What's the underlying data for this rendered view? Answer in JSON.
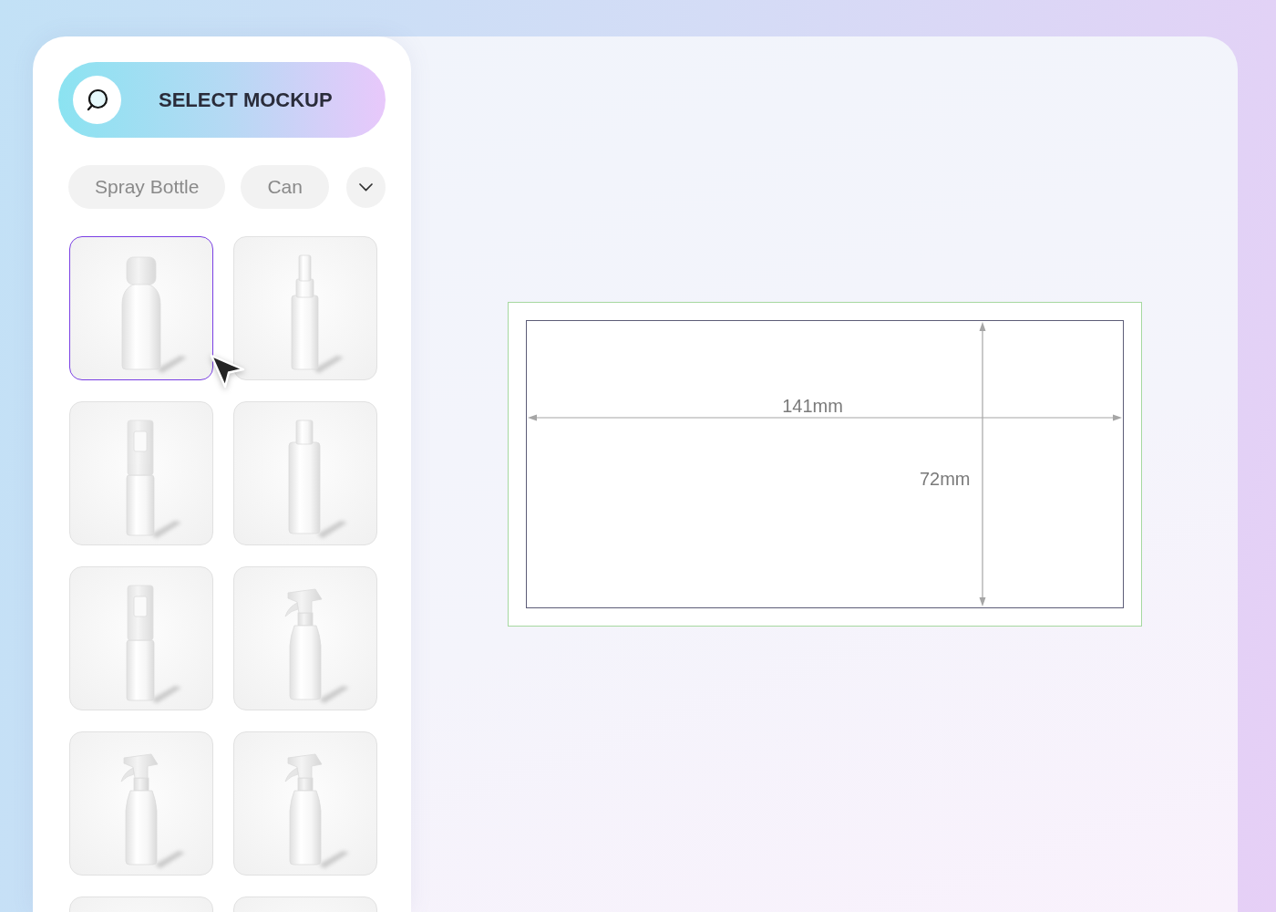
{
  "sidebar": {
    "select_button": {
      "label": "SELECT MOCKUP"
    },
    "filters": [
      {
        "label": "Spray Bottle",
        "selected": false
      },
      {
        "label": "Can",
        "selected": false
      }
    ],
    "more_filters": {
      "expanded": false
    },
    "mockups": [
      {
        "kind": "aerosol",
        "selected": true
      },
      {
        "kind": "mist",
        "selected": false
      },
      {
        "kind": "pump",
        "selected": false
      },
      {
        "kind": "cylinder",
        "selected": false
      },
      {
        "kind": "pump",
        "selected": false
      },
      {
        "kind": "trigger",
        "selected": false
      },
      {
        "kind": "trigger",
        "selected": false
      },
      {
        "kind": "trigger",
        "selected": false
      },
      {
        "selected": false
      },
      {
        "selected": false
      }
    ]
  },
  "canvas": {
    "dieline": {
      "width_label": "141mm",
      "height_label": "72mm"
    }
  }
}
